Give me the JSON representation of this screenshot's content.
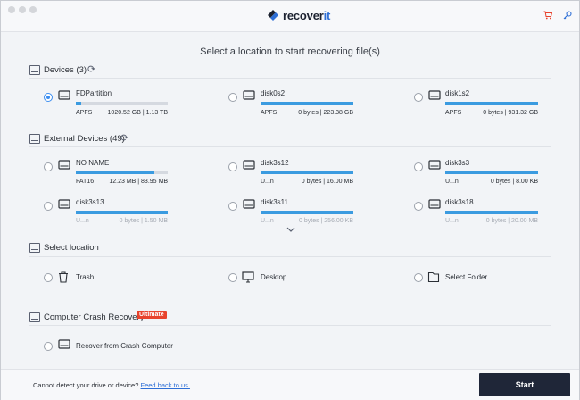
{
  "app": {
    "brand_main": "recover",
    "brand_accent": "it"
  },
  "header": {
    "prompt": "Select a location to start recovering file(s)"
  },
  "devices": {
    "title": "Devices (3)",
    "items": [
      {
        "name": "FDPartition",
        "fs": "APFS",
        "size": "1020.52 GB | 1.13 TB",
        "fill": 0.06,
        "selected": true
      },
      {
        "name": "disk0s2",
        "fs": "APFS",
        "size": "0 bytes | 223.38 GB",
        "fill": 1.0
      },
      {
        "name": "disk1s2",
        "fs": "APFS",
        "size": "0 bytes | 931.32 GB",
        "fill": 1.0
      }
    ]
  },
  "external": {
    "title": "External Devices (49)",
    "items": [
      {
        "name": "NO NAME",
        "fs": "FAT16",
        "size": "12.23 MB | 83.95 MB",
        "fill": 0.85
      },
      {
        "name": "disk3s12",
        "fs": "U...n",
        "size": "0 bytes | 16.00 MB",
        "fill": 1.0
      },
      {
        "name": "disk3s3",
        "fs": "U...n",
        "size": "0 bytes | 8.00 KB",
        "fill": 1.0
      },
      {
        "name": "disk3s13",
        "fs": "U...n",
        "size": "0 bytes | 1.50 MB",
        "fill": 1.0
      },
      {
        "name": "disk3s11",
        "fs": "U...n",
        "size": "0 bytes | 256.00 KB",
        "fill": 1.0
      },
      {
        "name": "disk3s18",
        "fs": "U...n",
        "size": "0 bytes | 20.00 MB",
        "fill": 1.0
      }
    ]
  },
  "location": {
    "title": "Select location",
    "items": [
      {
        "name": "Trash",
        "icon": "trash-icon"
      },
      {
        "name": "Desktop",
        "icon": "desktop-icon"
      },
      {
        "name": "Select Folder",
        "icon": "folder-icon"
      }
    ]
  },
  "crash": {
    "title": "Computer Crash Recovery",
    "badge": "Ultimate",
    "item": "Recover from Crash Computer"
  },
  "footer": {
    "prefix": "Cannot detect your drive or device?",
    "link": "Feed back to us.",
    "start": "Start"
  },
  "colors": {
    "accent": "#3b9be0",
    "badge": "#e8432d",
    "start_bg": "#1f2638"
  }
}
